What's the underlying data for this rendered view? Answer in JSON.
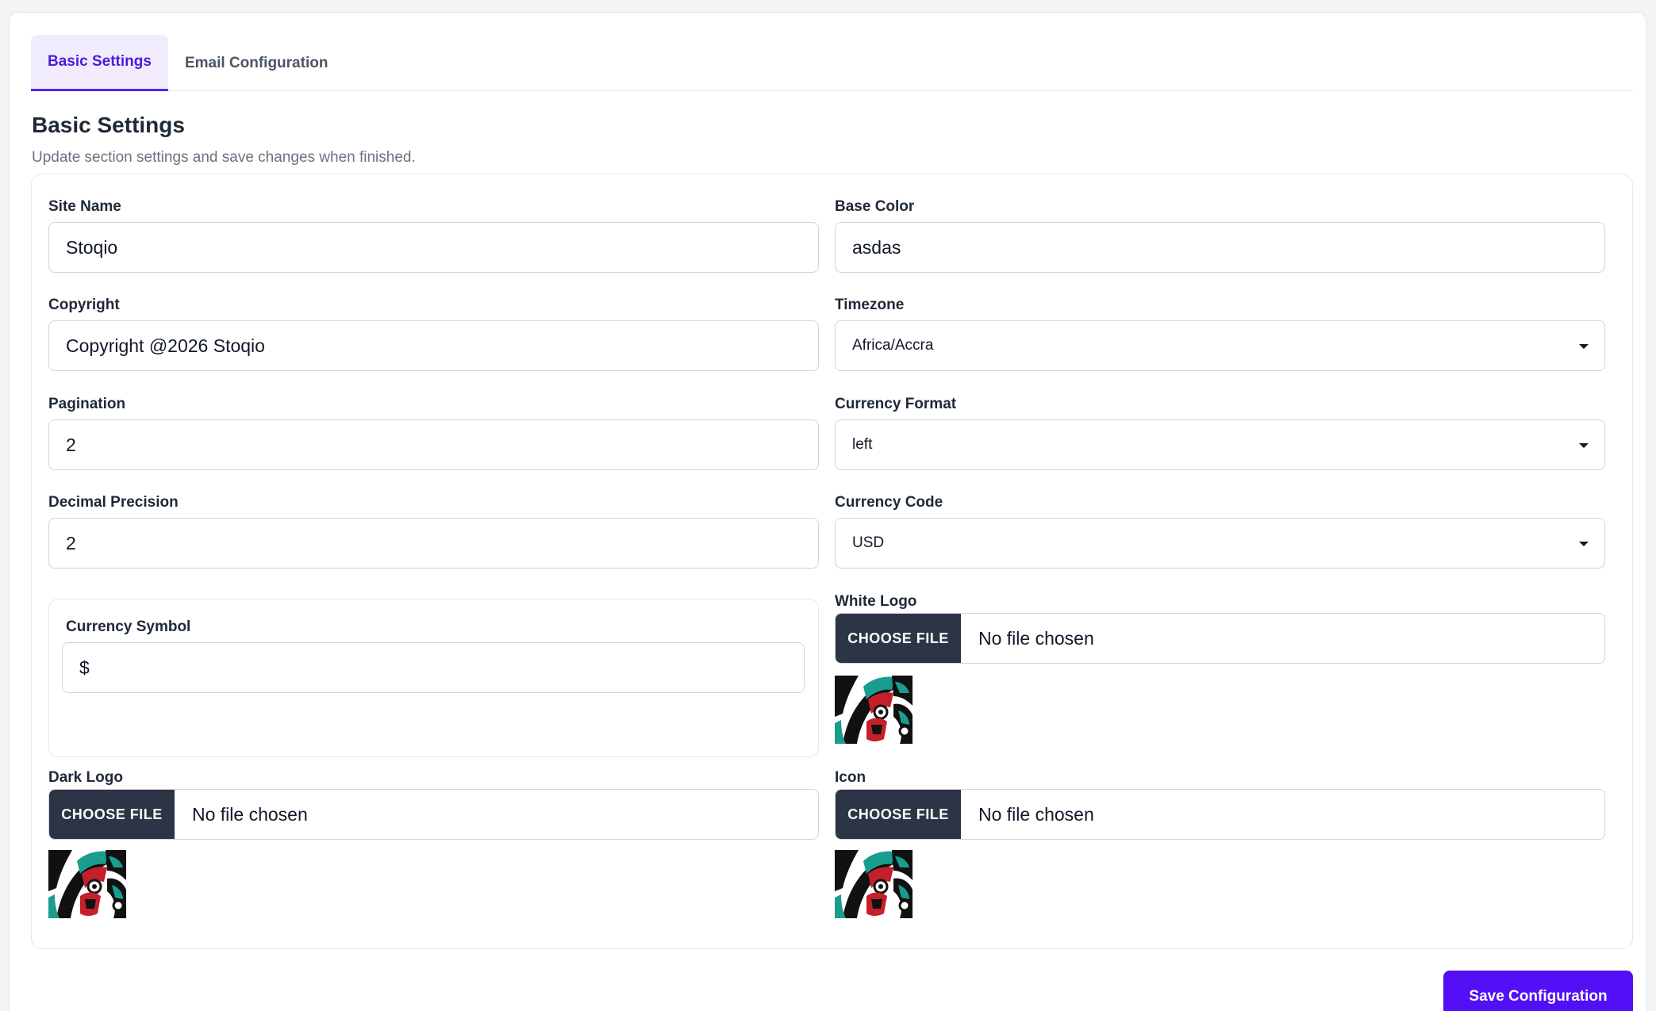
{
  "tabs": [
    {
      "label": "Basic Settings",
      "active": true
    },
    {
      "label": "Email Configuration",
      "active": false
    }
  ],
  "section": {
    "title": "Basic Settings",
    "description": "Update section settings and save changes when finished."
  },
  "fields": {
    "site_name": {
      "label": "Site Name",
      "value": "Stoqio"
    },
    "base_color": {
      "label": "Base Color",
      "value": "asdas"
    },
    "copyright": {
      "label": "Copyright",
      "value": "Copyright @2026 Stoqio"
    },
    "timezone": {
      "label": "Timezone",
      "value": "Africa/Accra"
    },
    "pagination": {
      "label": "Pagination",
      "value": "2"
    },
    "currency_format": {
      "label": "Currency Format",
      "value": "left"
    },
    "decimal_precision": {
      "label": "Decimal Precision",
      "value": "2"
    },
    "currency_code": {
      "label": "Currency Code",
      "value": "USD"
    },
    "currency_symbol": {
      "label": "Currency Symbol",
      "value": "$"
    },
    "white_logo": {
      "label": "White Logo",
      "button": "CHOOSE FILE",
      "status": "No file chosen"
    },
    "dark_logo": {
      "label": "Dark Logo",
      "button": "CHOOSE FILE",
      "status": "No file chosen"
    },
    "icon": {
      "label": "Icon",
      "button": "CHOOSE FILE",
      "status": "No file chosen"
    }
  },
  "actions": {
    "save_label": "Save Configuration"
  },
  "colors": {
    "accent": "#5310f6",
    "tab_active_text": "#4f1ad8",
    "file_button_bg": "#2d3446"
  }
}
